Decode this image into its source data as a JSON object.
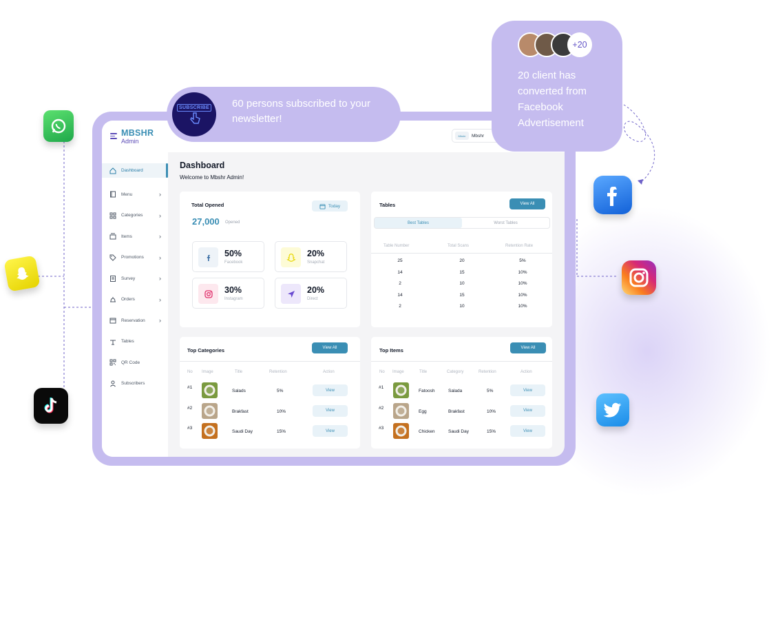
{
  "brand": {
    "name": "MBSHR",
    "sub": "Admin"
  },
  "sidebar": {
    "items": [
      {
        "label": "Dashboard",
        "icon": "home-icon",
        "active": true
      },
      {
        "label": "Menu",
        "icon": "menu-book-icon",
        "chevron": true
      },
      {
        "label": "Categories",
        "icon": "grid-icon",
        "chevron": true
      },
      {
        "label": "Items",
        "icon": "items-icon",
        "chevron": true
      },
      {
        "label": "Promotions",
        "icon": "tag-icon",
        "chevron": true
      },
      {
        "label": "Survey",
        "icon": "clipboard-icon",
        "chevron": true
      },
      {
        "label": "Orders",
        "icon": "cloche-icon",
        "chevron": true
      },
      {
        "label": "Reservation",
        "icon": "calendar-icon",
        "chevron": true
      },
      {
        "label": "Tables",
        "icon": "table-icon",
        "chevron": false
      },
      {
        "label": "QR Code",
        "icon": "qr-icon",
        "chevron": false
      },
      {
        "label": "Subscribers",
        "icon": "user-icon",
        "chevron": false
      }
    ]
  },
  "topbar": {
    "user_logo": "Mbshr",
    "user_name": "Mbshr"
  },
  "header": {
    "title": "Dashboard",
    "subtitle": "Welcome to Mbshr Admin!"
  },
  "total_opened": {
    "title": "Total Opened",
    "filter": "Today",
    "value": "27,000",
    "value_label": "Opened",
    "stats": [
      {
        "pct": "50%",
        "label": "Facebook",
        "icon": "facebook-icon",
        "bg": "#eef3f8",
        "color": "#3a6ea5"
      },
      {
        "pct": "20%",
        "label": "Snapchat",
        "icon": "snapchat-icon",
        "bg": "#fdfbd6",
        "color": "#e7d700"
      },
      {
        "pct": "30%",
        "label": "Instagram",
        "icon": "instagram-icon",
        "bg": "#fde8ee",
        "color": "#e1306c"
      },
      {
        "pct": "20%",
        "label": "Direct",
        "icon": "send-icon",
        "bg": "#ede7fb",
        "color": "#6a4bd1"
      }
    ]
  },
  "tables_card": {
    "title": "Tables",
    "view_all": "View All",
    "tabs": [
      "Best Tables",
      "Worst Tables"
    ],
    "columns": [
      "Table Number",
      "Total Scans",
      "Retention Rate"
    ],
    "rows": [
      [
        "25",
        "20",
        "5%"
      ],
      [
        "14",
        "15",
        "10%"
      ],
      [
        "2",
        "10",
        "10%"
      ],
      [
        "14",
        "15",
        "10%"
      ],
      [
        "2",
        "10",
        "10%"
      ]
    ]
  },
  "top_categories": {
    "title": "Top Categories",
    "view_all": "View All",
    "columns": [
      "No",
      "Image",
      "Title",
      "Retention",
      "Action"
    ],
    "rows": [
      {
        "no": "#1",
        "title": "Salads",
        "retention": "5%",
        "action": "View",
        "img": "#7a9a3f"
      },
      {
        "no": "#2",
        "title": "Brakfast",
        "retention": "10%",
        "action": "View",
        "img": "#b9a58a"
      },
      {
        "no": "#3",
        "title": "Saudi Day",
        "retention": "15%",
        "action": "View",
        "img": "#c4701f"
      }
    ]
  },
  "top_items": {
    "title": "Top Items",
    "view_all": "View All",
    "columns": [
      "No",
      "Image",
      "Title",
      "Category",
      "Retention",
      "Action"
    ],
    "rows": [
      {
        "no": "#1",
        "title": "Fatoosh",
        "category": "Salada",
        "retention": "5%",
        "action": "View",
        "img": "#7a9a3f"
      },
      {
        "no": "#2",
        "title": "Egg",
        "category": "Brakfast",
        "retention": "10%",
        "action": "View",
        "img": "#b9a58a"
      },
      {
        "no": "#3",
        "title": "Chicken",
        "category": "Saudi Day",
        "retention": "15%",
        "action": "View",
        "img": "#c4701f"
      }
    ]
  },
  "notifications": {
    "subscribe_icon_text": "SUBSCRIBE",
    "subscribe_text": "60 persons subscribed to your newsletter!",
    "avatars_more": "+20",
    "facebook_text": "20 client has converted from Facebook Advertisement"
  },
  "colors": {
    "accent": "#3a8eb4",
    "purple": "#c5bcef",
    "brand_purple": "#5b4bb7"
  }
}
